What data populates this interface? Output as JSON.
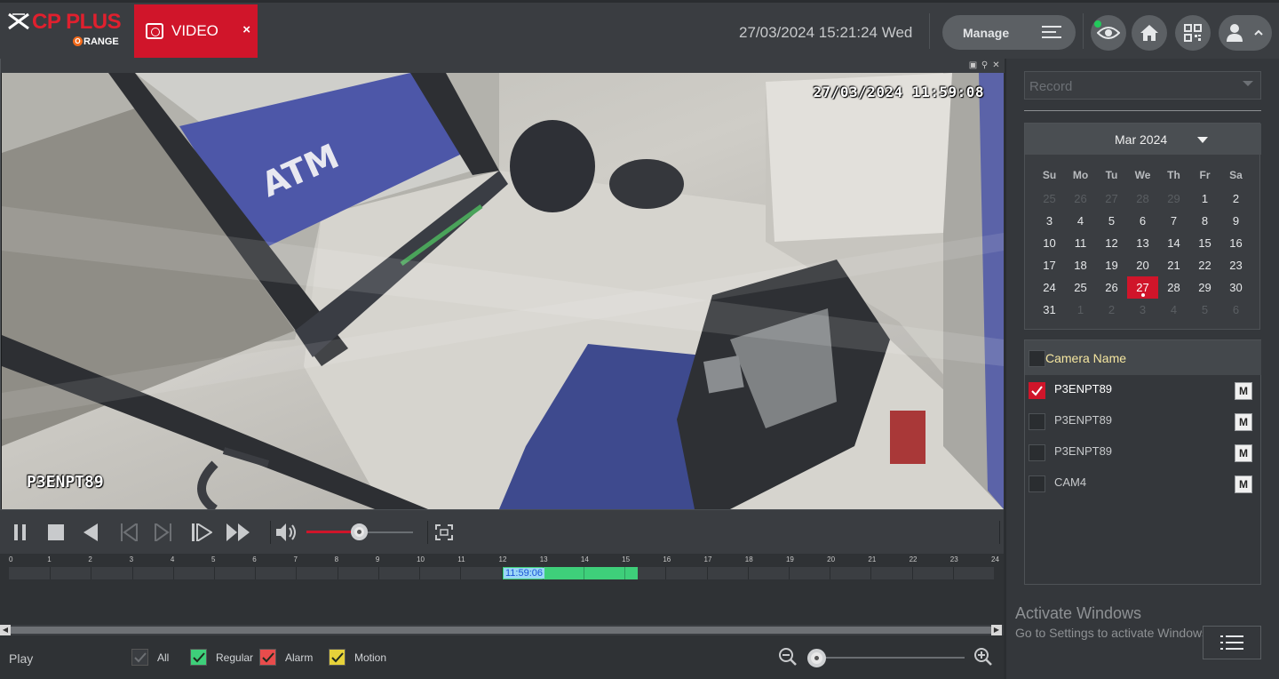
{
  "header": {
    "logo_main": "CP PLUS",
    "logo_sub_o": "O",
    "logo_sub": "RANGE",
    "tab_label": "VIDEO",
    "tab_close": "×",
    "datetime": "27/03/2024 15:21:24 Wed",
    "manage_label": "Manage",
    "status_color": "#22c95b",
    "accent_color": "#d0152a"
  },
  "video": {
    "osd_time": "27/03/2024 11:59:08",
    "osd_name": "P3ENPT89"
  },
  "volume": {
    "level": 0.5
  },
  "timeline": {
    "hours": [
      "0",
      "1",
      "2",
      "3",
      "4",
      "5",
      "6",
      "7",
      "8",
      "9",
      "10",
      "11",
      "12",
      "13",
      "14",
      "15",
      "16",
      "17",
      "18",
      "19",
      "20",
      "21",
      "22",
      "23",
      "24"
    ],
    "current_time": "11:59:06",
    "recording": {
      "start_hour": 12.0,
      "end_hour": 15.33,
      "color": "#3ecf7a"
    },
    "cursor_hour": 12.0
  },
  "bottom": {
    "play_label": "Play",
    "legend": [
      {
        "label": "All",
        "color": "#3a3d41",
        "checked": false
      },
      {
        "label": "Regular",
        "color": "#3ecf7a",
        "checked": true
      },
      {
        "label": "Alarm",
        "color": "#e84c4c",
        "checked": true
      },
      {
        "label": "Motion",
        "color": "#e6d23a",
        "checked": true
      }
    ],
    "zoom_level": 0.0
  },
  "sidebar": {
    "record_select": "Record",
    "calendar": {
      "month_label": "Mar 2024",
      "weekdays": [
        "Su",
        "Mo",
        "Tu",
        "We",
        "Th",
        "Fr",
        "Sa"
      ],
      "weeks": [
        [
          "25",
          "26",
          "27",
          "28",
          "29",
          "1",
          "2"
        ],
        [
          "3",
          "4",
          "5",
          "6",
          "7",
          "8",
          "9"
        ],
        [
          "10",
          "11",
          "12",
          "13",
          "14",
          "15",
          "16"
        ],
        [
          "17",
          "18",
          "19",
          "20",
          "21",
          "22",
          "23"
        ],
        [
          "24",
          "25",
          "26",
          "27",
          "28",
          "29",
          "30"
        ],
        [
          "31",
          "1",
          "2",
          "3",
          "4",
          "5",
          "6"
        ]
      ],
      "selected_day": "27"
    },
    "cameras_header": "Camera Name",
    "cameras": [
      {
        "name": "P3ENPT89",
        "checked": true,
        "m_label": "M"
      },
      {
        "name": "P3ENPT89",
        "checked": false,
        "m_label": "M"
      },
      {
        "name": "P3ENPT89",
        "checked": false,
        "m_label": "M"
      },
      {
        "name": "CAM4",
        "checked": false,
        "m_label": "M"
      }
    ]
  },
  "watermark": {
    "title": "Activate Windows",
    "subtitle": "Go to Settings to activate Windows."
  }
}
